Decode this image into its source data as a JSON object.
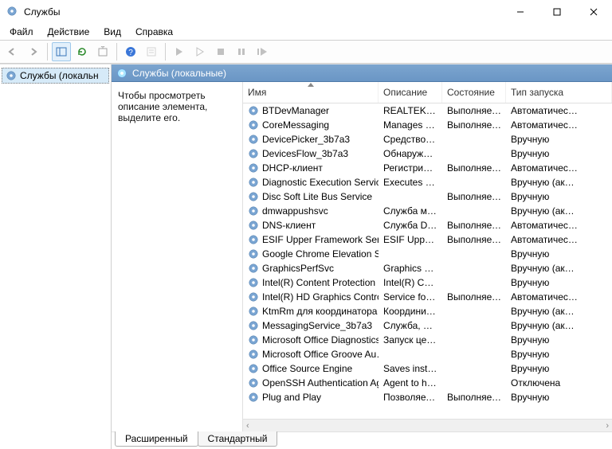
{
  "window": {
    "title": "Службы"
  },
  "menu": {
    "file": "Файл",
    "action": "Действие",
    "view": "Вид",
    "help": "Справка"
  },
  "tree": {
    "root": "Службы (локальн"
  },
  "content": {
    "header": "Службы (локальные)",
    "info": "Чтобы просмотреть описание элемента, выделите его."
  },
  "columns": {
    "name": "Имя",
    "desc": "Описание",
    "state": "Состояние",
    "start": "Тип запуска"
  },
  "tabs": {
    "extended": "Расширенный",
    "standard": "Стандартный"
  },
  "scrollhint": {
    "left": "‹",
    "right": "›"
  },
  "services": [
    {
      "name": "BTDevManager",
      "desc": "REALTEK Bl…",
      "state": "Выполняется",
      "start": "Автоматичес…"
    },
    {
      "name": "CoreMessaging",
      "desc": "Manages c…",
      "state": "Выполняется",
      "start": "Автоматичес…"
    },
    {
      "name": "DevicePicker_3b7a3",
      "desc": "Средство в…",
      "state": "",
      "start": "Вручную"
    },
    {
      "name": "DevicesFlow_3b7a3",
      "desc": "Обнаруже…",
      "state": "",
      "start": "Вручную"
    },
    {
      "name": "DHCP-клиент",
      "desc": "Регистриру…",
      "state": "Выполняется",
      "start": "Автоматичес…"
    },
    {
      "name": "Diagnostic Execution Service",
      "desc": "Executes di…",
      "state": "",
      "start": "Вручную (ак…"
    },
    {
      "name": "Disc Soft Lite Bus Service",
      "desc": "",
      "state": "Выполняется",
      "start": "Вручную"
    },
    {
      "name": "dmwappushsvc",
      "desc": "Служба ма…",
      "state": "",
      "start": "Вручную (ак…"
    },
    {
      "name": "DNS-клиент",
      "desc": "Служба D…",
      "state": "Выполняется",
      "start": "Автоматичес…"
    },
    {
      "name": "ESIF Upper Framework Service",
      "desc": "ESIF Upper …",
      "state": "Выполняется",
      "start": "Автоматичес…"
    },
    {
      "name": "Google Chrome Elevation Se…",
      "desc": "",
      "state": "",
      "start": "Вручную"
    },
    {
      "name": "GraphicsPerfSvc",
      "desc": "Graphics p…",
      "state": "",
      "start": "Вручную (ак…"
    },
    {
      "name": "Intel(R) Content Protection H…",
      "desc": "Intel(R) Con…",
      "state": "",
      "start": "Вручную"
    },
    {
      "name": "Intel(R) HD Graphics Control …",
      "desc": "Service for I…",
      "state": "Выполняется",
      "start": "Автоматичес…"
    },
    {
      "name": "KtmRm для координатора …",
      "desc": "Координи…",
      "state": "",
      "start": "Вручную (ак…"
    },
    {
      "name": "MessagingService_3b7a3",
      "desc": "Служба, от…",
      "state": "",
      "start": "Вручную (ак…"
    },
    {
      "name": "Microsoft Office Diagnostics…",
      "desc": "Запуск цен…",
      "state": "",
      "start": "Вручную"
    },
    {
      "name": "Microsoft Office Groove Au…",
      "desc": "",
      "state": "",
      "start": "Вручную"
    },
    {
      "name": "Office  Source Engine",
      "desc": "Saves instal…",
      "state": "",
      "start": "Вручную"
    },
    {
      "name": "OpenSSH Authentication Ag…",
      "desc": "Agent to h…",
      "state": "",
      "start": "Отключена"
    },
    {
      "name": "Plug and Play",
      "desc": "Позволяет …",
      "state": "Выполняется",
      "start": "Вручную"
    }
  ]
}
